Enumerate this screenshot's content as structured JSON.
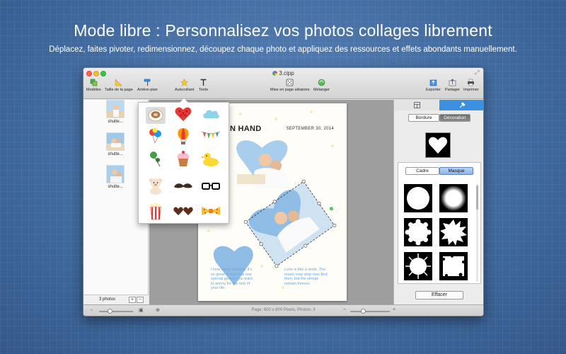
{
  "headline": "Mode libre : Personnalisez vos photos collages librement",
  "subheadline": "Déplacez, faites pivoter, redimensionnez, découpez chaque photo et appliquez des ressources et effets abondants manuellement.",
  "window": {
    "title": "3.cipp"
  },
  "toolbar": {
    "modeles": "Modèles",
    "taille": "Taille de la page",
    "arriere_plan": "Arrière-plan",
    "autocollant": "Autocollant",
    "texte": "Texte",
    "mise_en_page": "Mise en page aléatoire",
    "melanger": "Mélanger",
    "exporter": "Exporter",
    "partager": "Partager",
    "imprimer": "Imprimer"
  },
  "sidebar": {
    "photos": [
      {
        "label": "shutte..."
      },
      {
        "label": "shutte..."
      },
      {
        "label": "shutte..."
      }
    ],
    "count": "3 photos",
    "add": "+",
    "remove": "−"
  },
  "page": {
    "title": "D IN HAND",
    "date": "SEPTEMBER 30, 2014",
    "text_left": "I love being married. It's so great to find that one special person you want to annoy for the rest of your life.",
    "text_right": "Love is like a violin. The music may stop now and then, but the strings remain forever."
  },
  "stickers": [
    "coffee",
    "heart-balloon",
    "cloud",
    "balloons",
    "hot-air-balloon",
    "bunting",
    "push-pin",
    "cupcake",
    "rubber-duck",
    "teddy-bear",
    "mustache",
    "glasses",
    "popcorn",
    "heart-sunglasses",
    "bow-tie"
  ],
  "inspector": {
    "tab_layout_icon": "layout-icon",
    "tab_tools_icon": "tools-icon",
    "bordure": "Bordure",
    "decoration": "Décoration",
    "cadre": "Cadre",
    "masque": "Masque",
    "effacer": "Effacer"
  },
  "statusbar": {
    "info": "Page: 600 x 800 Pixels, Photos: 3"
  },
  "colors": {
    "background": "#3f6aa0",
    "selection_blue": "#3d8fe0",
    "page_text": "#6aa7d9"
  }
}
